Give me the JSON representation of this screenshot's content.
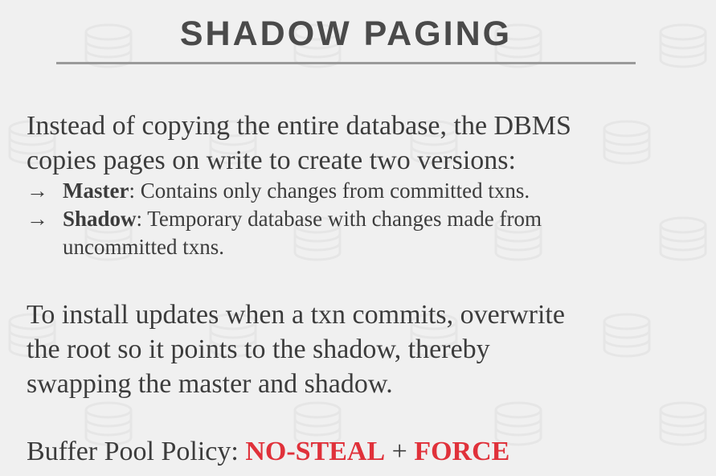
{
  "title": "SHADOW PAGING",
  "intro": {
    "line1": "Instead of copying the entire database, the DBMS",
    "line2": "copies pages on write to create two versions:"
  },
  "bullets": [
    {
      "arrow": "→",
      "term": "Master",
      "desc": ": Contains only changes from committed txns."
    },
    {
      "arrow": "→",
      "term": "Shadow",
      "desc": ": Temporary database with changes made from",
      "desc_cont": "uncommitted txns."
    }
  ],
  "install": {
    "line1": "To install updates when a txn commits, overwrite",
    "line2": "the root so it points to the shadow, thereby",
    "line3": "swapping the master and shadow."
  },
  "policy": {
    "label": "Buffer Pool Policy: ",
    "steal": "NO-STEAL",
    "plus": " + ",
    "force": "FORCE"
  },
  "colors": {
    "background": "#f0f0f0",
    "text": "#3c3c3c",
    "accent": "#e0313a",
    "rule": "#9a9a9a"
  },
  "icons": {
    "background_pattern": "database-cylinder-icon"
  }
}
